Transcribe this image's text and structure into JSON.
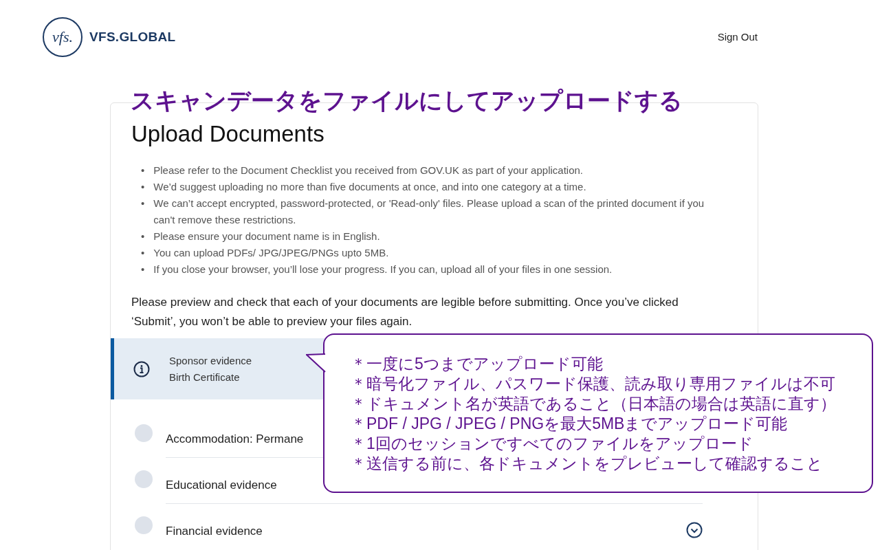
{
  "header": {
    "logo_text": "VFS.GLOBAL",
    "logo_mark": "vfs.",
    "sign_out": "Sign Out"
  },
  "annotation_title": "スキャンデータをファイルにしてアップロードする",
  "page": {
    "title": "Upload Documents",
    "bullets": [
      {
        "marker": "•",
        "text": "Please refer to the Document Checklist you received from GOV.UK as part of your application."
      },
      {
        "marker": "•",
        "text": "We’d suggest uploading no more than five documents at once, and into one category at a time."
      },
      {
        "marker": "•",
        "text": "We can’t accept encrypted, password-protected, or 'Read-only' files. Please upload a scan of the printed document if you can't remove these restrictions."
      },
      {
        "marker": "•",
        "text": "Please ensure your document name is in English."
      },
      {
        "marker": "•",
        "text": "You can upload PDFs/ JPG/JPEG/PNGs upto 5MB."
      },
      {
        "marker": "•",
        "text": "If you close your browser, you’ll lose your progress. If you can, upload all of your files in one session."
      }
    ],
    "notice": "Please preview and check that each of your documents are legible before submitting. Once you’ve clicked ‘Submit’, you won’t be able to preview your files again.",
    "info_box": {
      "lines": [
        "Sponsor evidence",
        "Birth Certificate"
      ]
    },
    "categories": [
      {
        "title": "Accommodation: Permane"
      },
      {
        "title": "Educational evidence"
      },
      {
        "title": "Financial evidence",
        "expanded": false
      }
    ]
  },
  "callout": {
    "lines": [
      "＊一度に5つまでアップロード可能",
      "＊暗号化ファイル、パスワード保護、読み取り専用ファイルは不可",
      "＊ドキュメント名が英語であること（日本語の場合は英語に直す）",
      "＊PDF / JPG / JPEG / PNGを最大5MBまでアップロード可能",
      "＊1回のセッションですべてのファイルをアップロード",
      "＊送信する前に、各ドキュメントをプレビューして確認すること"
    ]
  }
}
